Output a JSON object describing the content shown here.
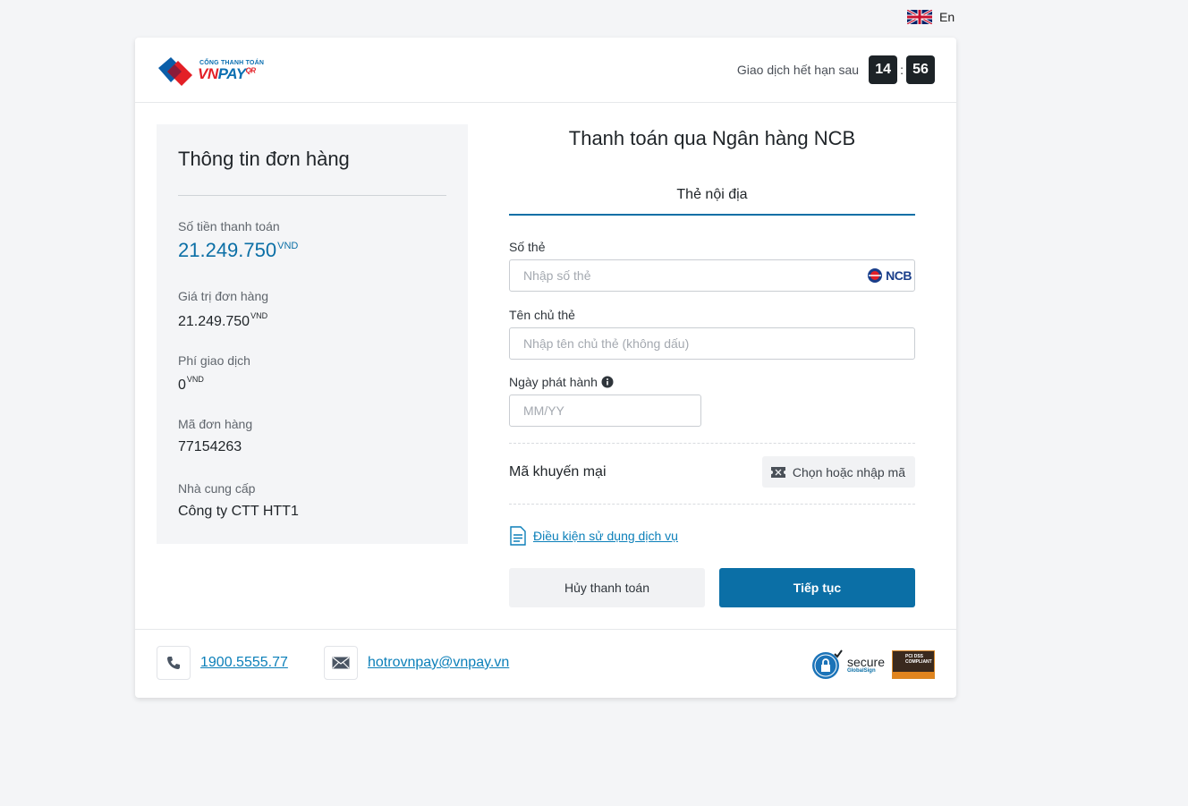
{
  "language": {
    "label": "En",
    "icon": "uk-flag-icon"
  },
  "header": {
    "logo": {
      "small": "CỔNG THANH TOÁN",
      "main_red": "VN",
      "main_blue": "PAY",
      "suffix": "QR"
    },
    "timer_label": "Giao dịch hết hạn sau",
    "minutes": "14",
    "separator": ":",
    "seconds": "56"
  },
  "order": {
    "title": "Thông tin đơn hàng",
    "amount_label": "Số tiền thanh toán",
    "amount_value": "21.249.750",
    "currency": "VND",
    "order_value_label": "Giá trị đơn hàng",
    "order_value": "21.249.750",
    "fee_label": "Phí giao dịch",
    "fee_value": "0",
    "order_id_label": "Mã đơn hàng",
    "order_id": "77154263",
    "provider_label": "Nhà cung cấp",
    "provider": "Công ty CTT HTT1"
  },
  "payment": {
    "title": "Thanh toán qua Ngân hàng NCB",
    "tab": "Thẻ nội địa",
    "card_number_label": "Số thẻ",
    "card_number_placeholder": "Nhập số thẻ",
    "bank_logo": "NCB",
    "holder_label": "Tên chủ thẻ",
    "holder_placeholder": "Nhập tên chủ thẻ (không dấu)",
    "issue_date_label": "Ngày phát hành",
    "issue_date_placeholder": "MM/YY",
    "promo_label": "Mã khuyến mại",
    "promo_button": "Chọn hoặc nhập mã",
    "terms_link": "Điều kiện sử dụng dịch vụ",
    "cancel_button": "Hủy thanh toán",
    "continue_button": "Tiếp tục"
  },
  "footer": {
    "phone": "1900.5555.77",
    "email": "hotrovnpay@vnpay.vn",
    "secure_text": "secure",
    "secure_sub": "GlobalSign",
    "pci_text": "PCI DSS COMPLIANT"
  },
  "colors": {
    "primary": "#0b6fa6",
    "link": "#0b7fb9",
    "timer_bg": "#1d2327",
    "panel_bg": "#f4f5f7"
  }
}
